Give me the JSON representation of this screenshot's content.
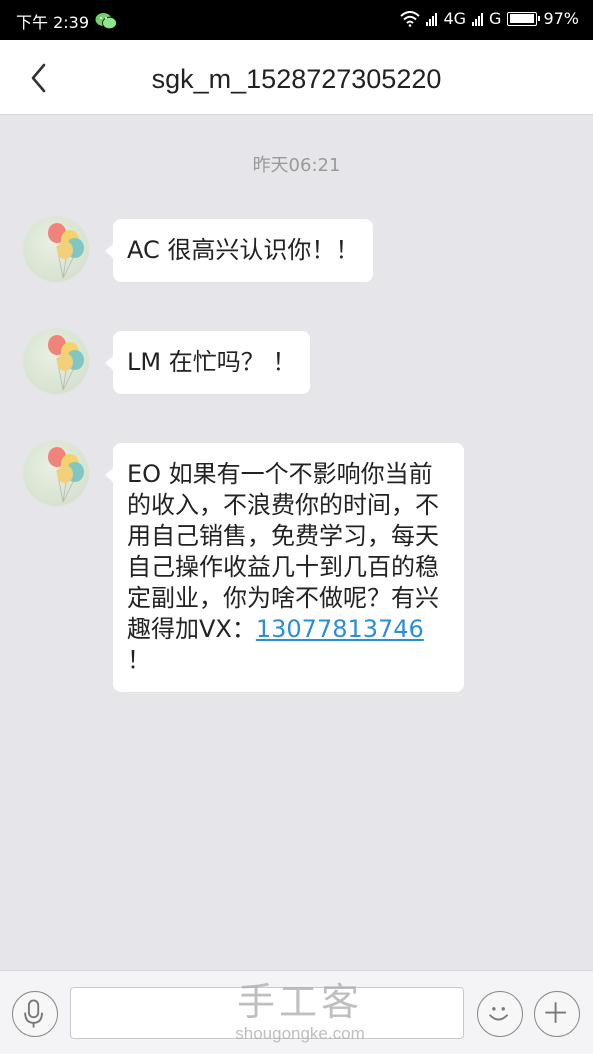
{
  "status_bar": {
    "time": "下午 2:39",
    "network_1": "4G",
    "network_2": "G",
    "battery_percent": "97%",
    "battery_level": 0.97,
    "icons": [
      "wechat-icon",
      "wifi-icon",
      "signal-icon",
      "battery-icon"
    ]
  },
  "header": {
    "title": "sgk_m_1528727305220",
    "back_icon": "chevron-left-icon"
  },
  "conversation": {
    "timestamp": "昨天06:21",
    "messages": [
      {
        "text": "AC  很高兴认识你！！"
      },
      {
        "text": "LM  在忙吗？  ！"
      },
      {
        "text": "EO  如果有一个不影响你当前的收入，不浪费你的时间，不用自己销售，免费学习，每天自己操作收益几十到几百的稳定副业，你为啥不做呢？有兴趣得加VX：",
        "link": "13077813746",
        "suffix": "  ！"
      }
    ]
  },
  "input_bar": {
    "value": "",
    "icons": [
      "microphone-icon",
      "emoji-icon",
      "plus-icon"
    ]
  },
  "watermark": {
    "text_cn": "手工客",
    "text_en": "shougongke.com"
  }
}
